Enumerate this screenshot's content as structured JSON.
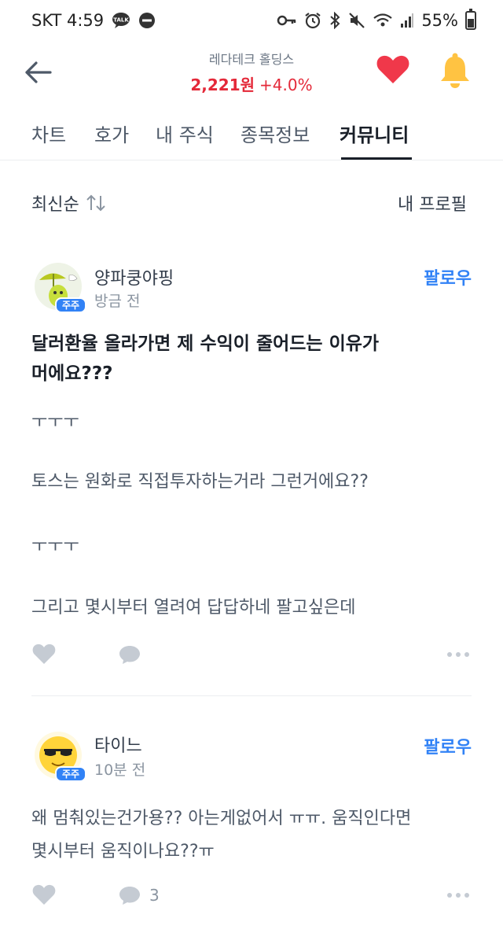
{
  "status_bar": {
    "carrier_time": "SKT 4:59",
    "talk_badge": "TALK",
    "battery_pct": "55%",
    "battery_level": 0.55
  },
  "header": {
    "stock_name": "레다테크 홀딩스",
    "price": "2,221원",
    "change": "+4.0%",
    "price_color": "#e42939",
    "heart_color": "#f0384a",
    "bell_color": "#ffc342"
  },
  "tabs": [
    {
      "label": "차트"
    },
    {
      "label": "호가"
    },
    {
      "label": "내 주식"
    },
    {
      "label": "종목정보"
    },
    {
      "label": "커뮤니티",
      "active": true
    }
  ],
  "sort": {
    "label": "최신순",
    "profile": "내 프로필"
  },
  "posts": [
    {
      "username": "양파쿵야핑",
      "time": "방금 전",
      "badge": "주주",
      "follow": "팔로우",
      "title_lines": [
        "달러환율 올라가면 제 수익이 줄어드는 이유가",
        "머에요???"
      ],
      "body": [
        "ㅜㅜㅜ",
        "토스는 원화로 직접투자하는거라 그런거에요??",
        "ㅜㅜㅜ",
        "그리고 몇시부터 열려여 답답하네 팔고싶은데"
      ],
      "comment_count": ""
    },
    {
      "username": "타이느",
      "time": "10분 전",
      "badge": "주주",
      "follow": "팔로우",
      "body": [
        "왜 멈춰있는건가용?? 아는게없어서 ㅠㅠ. 움직인다면",
        "몇시부터 움직이나요??ㅠ"
      ],
      "comment_count": "3"
    }
  ],
  "accent": "#3182f6"
}
